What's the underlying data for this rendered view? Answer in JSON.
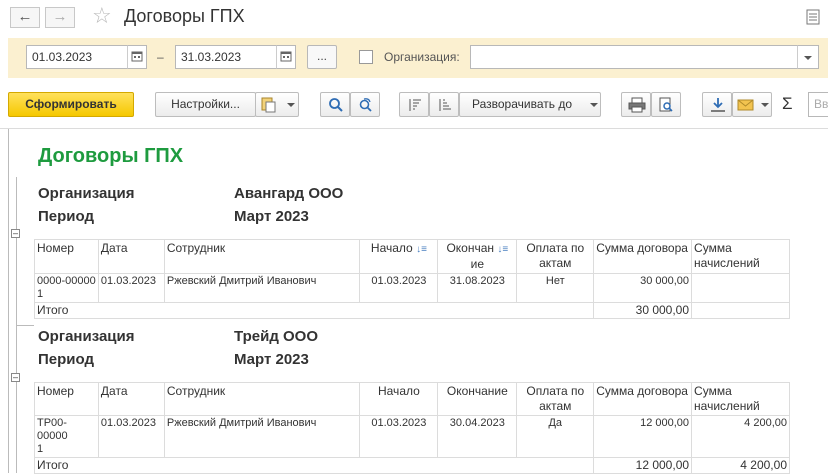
{
  "window": {
    "title": "Договоры ГПХ"
  },
  "filters": {
    "date_from": "01.03.2023",
    "date_to": "31.03.2023",
    "dash": "–",
    "dots": "...",
    "org_label": "Организация:",
    "org_value": ""
  },
  "toolbar": {
    "generate": "Сформировать",
    "settings": "Настройки...",
    "expand_to": "Разворачивать до",
    "search_placeholder": "Вв"
  },
  "report": {
    "title": "Договоры ГПХ",
    "org_label": "Организация",
    "period_label": "Период",
    "columns": [
      "Номер",
      "Дата",
      "Сотрудник",
      "Начало",
      "Окончание",
      "Оплата по актам",
      "Сумма договора",
      "Сумма начислений"
    ],
    "total_label": "Итого",
    "groups": [
      {
        "org": "Авангард ООО",
        "period": "Март 2023",
        "col_end_1": "Окончан",
        "col_end_2": "ие",
        "rows": [
          {
            "num_1": "0000-00000",
            "num_2": "1",
            "date": "01.03.2023",
            "employee": "Ржевский Дмитрий Иванович",
            "start": "01.03.2023",
            "end": "31.08.2023",
            "paid": "Нет",
            "sum": "30 000,00",
            "accr": ""
          }
        ],
        "total_sum": "30 000,00",
        "total_accr": ""
      },
      {
        "org": "Трейд ООО",
        "period": "Март 2023",
        "rows": [
          {
            "num_1": "ТР00-00000",
            "num_2": "1",
            "date": "01.03.2023",
            "employee": "Ржевский Дмитрий Иванович",
            "start": "01.03.2023",
            "end": "30.04.2023",
            "paid": "Да",
            "sum": "12 000,00",
            "accr": "4 200,00"
          }
        ],
        "total_sum": "12 000,00",
        "total_accr": "4 200,00"
      }
    ]
  }
}
